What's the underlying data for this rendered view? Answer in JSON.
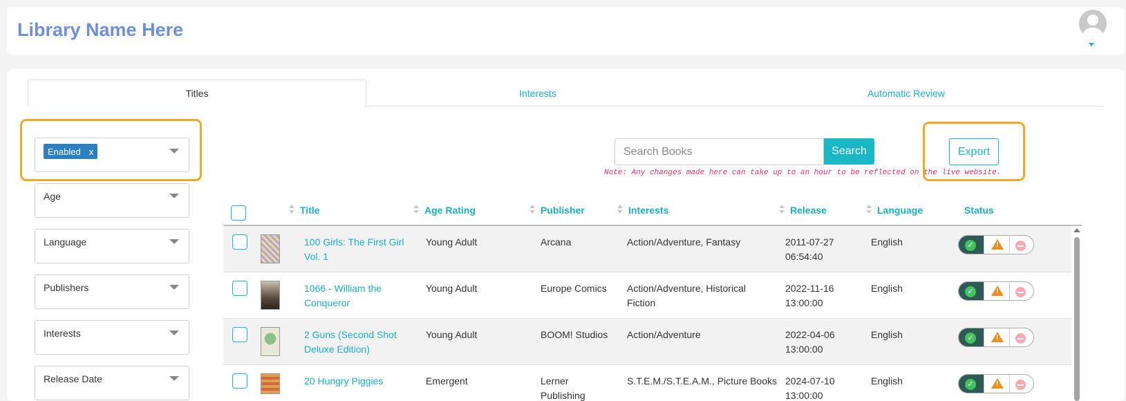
{
  "header": {
    "library_name": "Library Name Here"
  },
  "tabs": [
    {
      "label": "Titles"
    },
    {
      "label": "Interests"
    },
    {
      "label": "Automatic Review"
    }
  ],
  "filters": {
    "status_chip": {
      "label": "Enabled",
      "remove": "x"
    },
    "items": [
      {
        "label": "Age"
      },
      {
        "label": "Language"
      },
      {
        "label": "Publishers"
      },
      {
        "label": "Interests"
      },
      {
        "label": "Release Date"
      }
    ]
  },
  "search": {
    "placeholder": "Search Books",
    "button": "Search"
  },
  "note": "Note: Any changes made here can take up to an hour to be reflected on the live website.",
  "export_label": "Export",
  "table": {
    "columns": [
      "Title",
      "Age Rating",
      "Publisher",
      "Interests",
      "Release",
      "Language",
      "Status"
    ],
    "rows": [
      {
        "title_l1": "100 Girls: The First Girl",
        "title_l2": "Vol. 1",
        "age": "Young Adult",
        "publisher_l1": "Arcana",
        "publisher_l2": "",
        "interests_l1": "Action/Adventure, Fantasy",
        "interests_l2": "",
        "release_l1": "2011-07-27",
        "release_l2": "06:54:40",
        "language": "English"
      },
      {
        "title_l1": "1066 - William the",
        "title_l2": "Conqueror",
        "age": "Young Adult",
        "publisher_l1": "Europe Comics",
        "publisher_l2": "",
        "interests_l1": "Action/Adventure, Historical",
        "interests_l2": "Fiction",
        "release_l1": "2022-11-16",
        "release_l2": "13:00:00",
        "language": "English"
      },
      {
        "title_l1": "2 Guns (Second Shot",
        "title_l2": "Deluxe Edition)",
        "age": "Young Adult",
        "publisher_l1": "BOOM! Studios",
        "publisher_l2": "",
        "interests_l1": "Action/Adventure",
        "interests_l2": "",
        "release_l1": "2022-04-06",
        "release_l2": "13:00:00",
        "language": "English"
      },
      {
        "title_l1": "20 Hungry Piggies",
        "title_l2": "",
        "age": "Emergent",
        "publisher_l1": "Lerner",
        "publisher_l2": "Publishing",
        "interests_l1": "S.T.E.M./S.T.E.A.M., Picture Books",
        "interests_l2": "",
        "release_l1": "2024-07-10",
        "release_l2": "13:00:00",
        "language": "English"
      }
    ]
  },
  "colors": {
    "accent": "#1ab8c4",
    "highlight": "#f0a825",
    "brand": "#6f8fdc",
    "chip": "#2e7fc0",
    "note": "#e0356a"
  }
}
